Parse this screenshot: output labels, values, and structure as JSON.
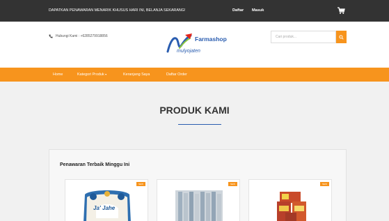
{
  "topbar": {
    "promo": "DAPATKAN PENAWARAN MENARIK KHUSUS HARI INI, BELANJA SEKARANG!",
    "register": "Daftar",
    "login": "Masuk",
    "cart_icon": "cart-icon"
  },
  "header": {
    "phone_icon": "phone-icon",
    "phone": "Hubungi Kami : +6285279918856",
    "logo": {
      "brand": "Farmashop",
      "sub": "mulyojaten"
    },
    "search": {
      "placeholder": "Cari produk...",
      "icon": "search-icon"
    }
  },
  "nav": {
    "items": [
      "Home",
      "Kategori Produk",
      "Keranjang Saya",
      "Daftar Order"
    ]
  },
  "main": {
    "title": "PRODUK KAMI",
    "panel_title": "Penawaran Terbaik Minggu Ini",
    "cards": [
      {
        "badge": "NEW",
        "img_text": "Ja' Jahe"
      },
      {
        "badge": "NEW"
      },
      {
        "badge": "NEW"
      }
    ]
  },
  "colors": {
    "accent": "#f7941d",
    "topbar": "#333333",
    "brand": "#2a5db0",
    "background": "#f1f1f1"
  }
}
